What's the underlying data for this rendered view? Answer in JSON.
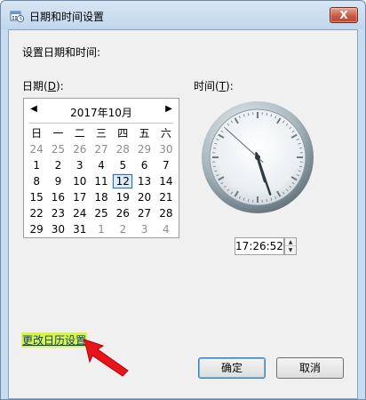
{
  "window": {
    "title": "日期和时间设置",
    "close_label": "X"
  },
  "heading": "设置日期和时间:",
  "date_label": {
    "text": "日期(",
    "key": "D",
    "suffix": "):"
  },
  "time_label": {
    "text": "时间(",
    "key": "T",
    "suffix": "):"
  },
  "calendar": {
    "month_title": "2017年10月",
    "prev_arrow": "◀",
    "next_arrow": "▶",
    "weekdays": [
      "日",
      "一",
      "二",
      "三",
      "四",
      "五",
      "六"
    ],
    "weeks": [
      [
        "24",
        "25",
        "26",
        "27",
        "28",
        "29",
        "30"
      ],
      [
        "1",
        "2",
        "3",
        "4",
        "5",
        "6",
        "7"
      ],
      [
        "8",
        "9",
        "10",
        "11",
        "12",
        "13",
        "14"
      ],
      [
        "15",
        "16",
        "17",
        "18",
        "19",
        "20",
        "21"
      ],
      [
        "22",
        "23",
        "24",
        "25",
        "26",
        "27",
        "28"
      ],
      [
        "29",
        "30",
        "31",
        "1",
        "2",
        "3",
        "4"
      ]
    ],
    "selected_day": "12"
  },
  "clock": {
    "hours": 17,
    "minutes": 26,
    "seconds": 52
  },
  "time_value": "17:26:52",
  "change_calendar_link": "更改日历设置",
  "buttons": {
    "ok": "确定",
    "cancel": "取消"
  },
  "colors": {
    "link_highlight": "#d9f542",
    "arrow": "#e8141c"
  }
}
